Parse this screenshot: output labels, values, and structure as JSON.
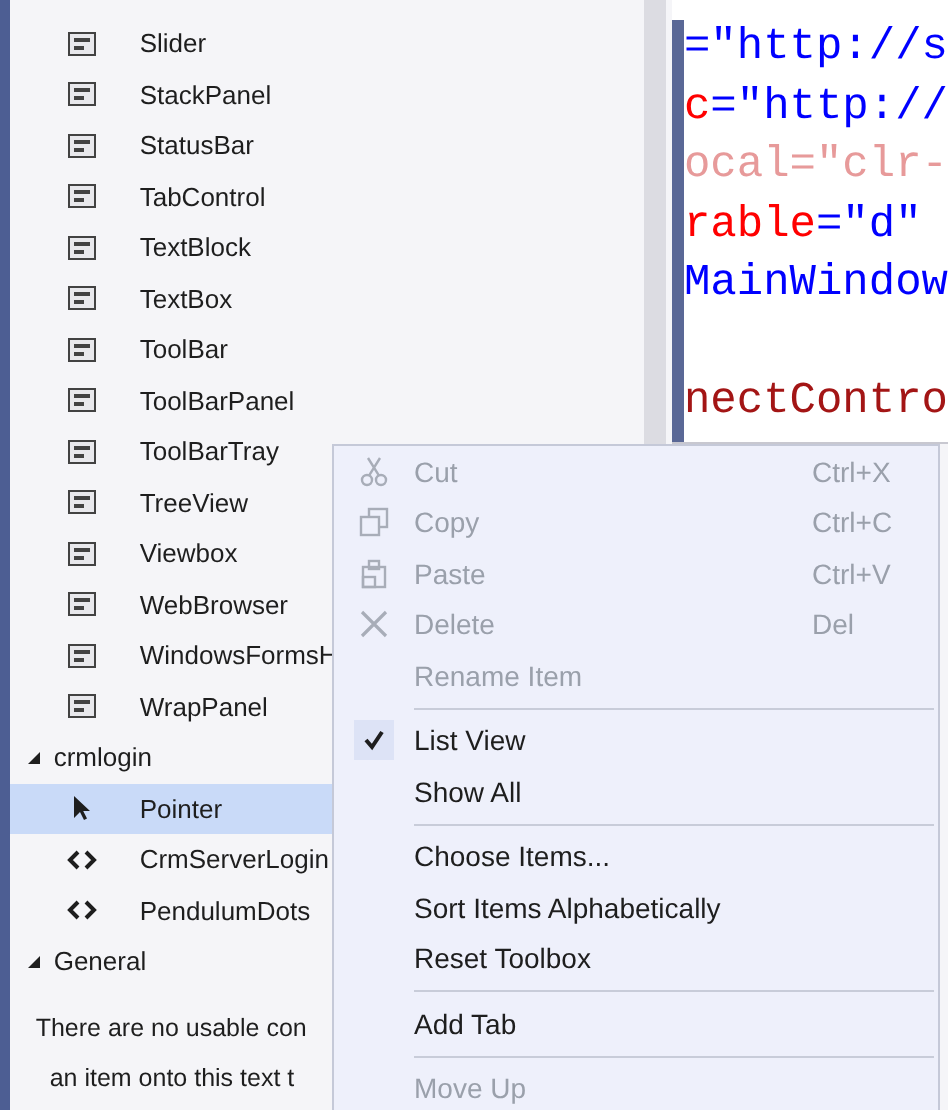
{
  "toolbox": {
    "items": [
      {
        "label": "Slider",
        "kind": "control"
      },
      {
        "label": "StackPanel",
        "kind": "control"
      },
      {
        "label": "StatusBar",
        "kind": "control"
      },
      {
        "label": "TabControl",
        "kind": "control"
      },
      {
        "label": "TextBlock",
        "kind": "control"
      },
      {
        "label": "TextBox",
        "kind": "control"
      },
      {
        "label": "ToolBar",
        "kind": "control"
      },
      {
        "label": "ToolBarPanel",
        "kind": "control"
      },
      {
        "label": "ToolBarTray",
        "kind": "control"
      },
      {
        "label": "TreeView",
        "kind": "control"
      },
      {
        "label": "Viewbox",
        "kind": "control"
      },
      {
        "label": "WebBrowser",
        "kind": "control"
      },
      {
        "label": "WindowsFormsH",
        "kind": "control"
      },
      {
        "label": "WrapPanel",
        "kind": "control"
      }
    ],
    "groups": [
      {
        "label": "crmlogin",
        "expanded": true,
        "items": [
          {
            "label": "Pointer",
            "kind": "pointer",
            "selected": true
          },
          {
            "label": "CrmServerLogin",
            "kind": "component",
            "selected": false
          },
          {
            "label": "PendulumDots",
            "kind": "component",
            "selected": false
          }
        ]
      },
      {
        "label": "General",
        "expanded": true,
        "message": [
          "There are no usable con",
          "an item onto this text t"
        ]
      }
    ]
  },
  "editor": {
    "lines": [
      {
        "segments": [
          {
            "text": "=\"http://s",
            "kind": "value"
          }
        ]
      },
      {
        "segments": [
          {
            "text": "c",
            "kind": "attribute"
          },
          {
            "text": "=\"http://",
            "kind": "value"
          }
        ]
      },
      {
        "segments": [
          {
            "text": "ocal=\"clr-",
            "kind": "faded"
          }
        ]
      },
      {
        "segments": [
          {
            "text": "rable",
            "kind": "attribute"
          },
          {
            "text": "=\"d\"",
            "kind": "value"
          }
        ]
      },
      {
        "segments": [
          {
            "text": "MainWindow",
            "kind": "value"
          }
        ]
      },
      {
        "segments": [
          {
            "text": "nectContro",
            "kind": "element"
          }
        ],
        "after_blank_line": true
      }
    ]
  },
  "context_menu": {
    "groups": [
      [
        {
          "label": "Cut",
          "shortcut": "Ctrl+X",
          "disabled": true
        },
        {
          "label": "Copy",
          "shortcut": "Ctrl+C",
          "disabled": true
        },
        {
          "label": "Paste",
          "shortcut": "Ctrl+V",
          "disabled": true
        },
        {
          "label": "Delete",
          "shortcut": "Del",
          "disabled": true
        },
        {
          "label": "Rename Item",
          "disabled": true
        }
      ],
      [
        {
          "label": "List View",
          "checked": true,
          "disabled": false
        },
        {
          "label": "Show All",
          "checked": false,
          "disabled": false
        }
      ],
      [
        {
          "label": "Choose Items...",
          "disabled": false
        },
        {
          "label": "Sort Items Alphabetically",
          "disabled": false
        },
        {
          "label": "Reset Toolbox",
          "disabled": false
        }
      ],
      [
        {
          "label": "Add Tab",
          "disabled": false
        }
      ],
      [
        {
          "label": "Move Up",
          "disabled": true
        }
      ]
    ]
  }
}
